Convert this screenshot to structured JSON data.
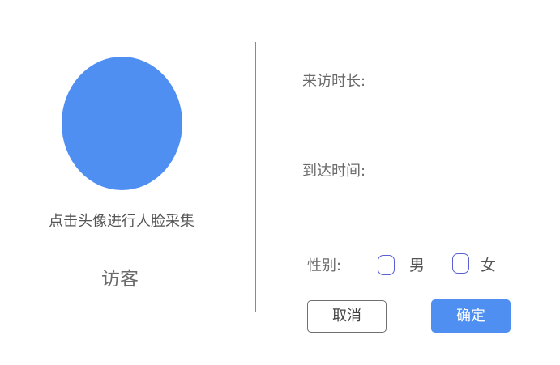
{
  "visitor_panel": {
    "capture_hint": "点击头像进行人脸采集",
    "role_label": "访客"
  },
  "form": {
    "duration_label": "来访时长:",
    "duration_value": "",
    "arrival_label": "到达时间:",
    "arrival_value": "",
    "gender_label": "性别:",
    "gender_options": [
      "男",
      "女"
    ],
    "gender_selected": ""
  },
  "actions": {
    "cancel_label": "取消",
    "confirm_label": "确定"
  },
  "colors": {
    "accent": "#4f8ff1",
    "radio_border": "#5b5fd6",
    "divider": "#8a8a8a"
  }
}
